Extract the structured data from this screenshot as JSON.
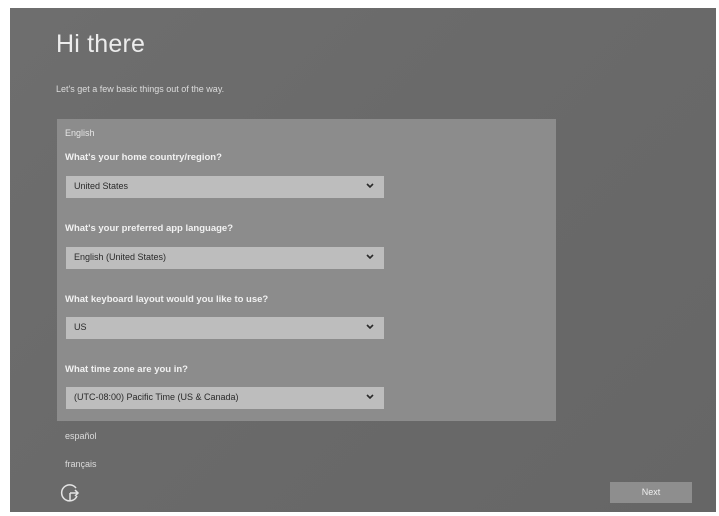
{
  "header": {
    "title": "Hi there",
    "subtitle": "Let's get a few basic things out of the way."
  },
  "panel": {
    "language": "English",
    "fields": [
      {
        "question": "What's your home country/region?",
        "value": "United States"
      },
      {
        "question": "What's your preferred app language?",
        "value": "English (United States)"
      },
      {
        "question": "What keyboard layout would you like to use?",
        "value": "US"
      },
      {
        "question": "What time zone are you in?",
        "value": "(UTC-08:00) Pacific Time (US & Canada)"
      }
    ]
  },
  "other_languages": [
    "español",
    "français"
  ],
  "footer": {
    "accessibility_icon": "ease-of-access-icon",
    "next_label": "Next"
  },
  "colors": {
    "background": "#6a6a6a",
    "panel": "#8c8c8c",
    "dropdown": "#bdbdbd",
    "text": "#ececec"
  }
}
